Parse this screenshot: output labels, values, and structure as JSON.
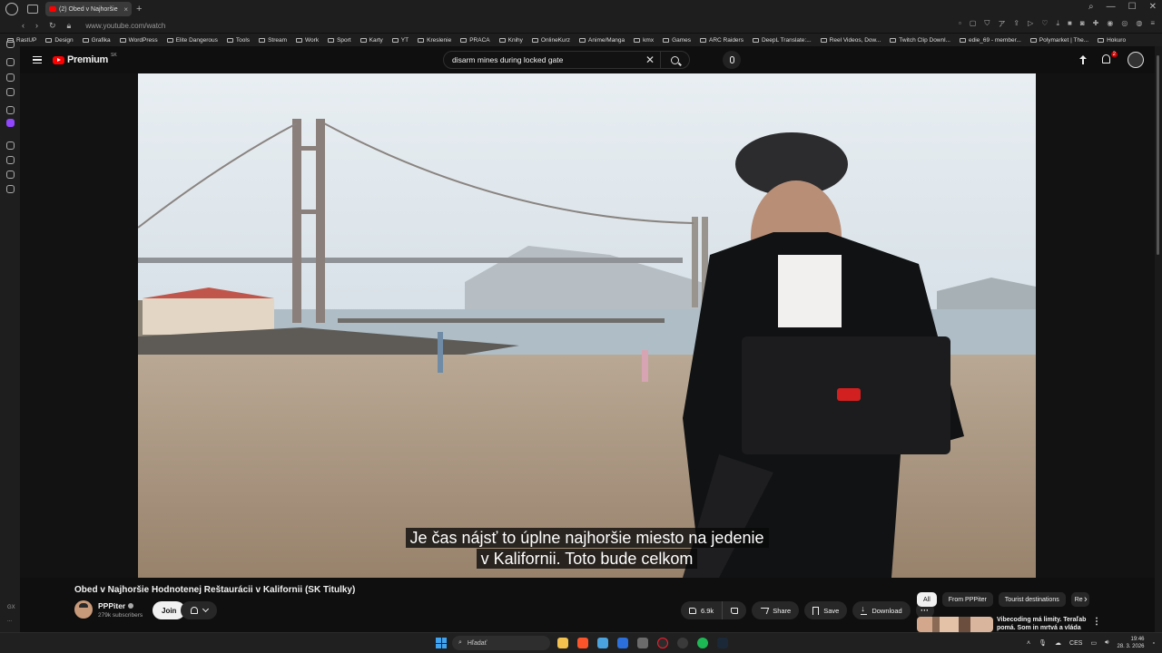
{
  "browser": {
    "tab_title": "(2) Obed v Najhoršie",
    "url": "www.youtube.com/watch",
    "bookmarks": [
      "RastUP",
      "Design",
      "Grafika",
      "WordPress",
      "Elite Dangerous",
      "Tools",
      "Stream",
      "Work",
      "Sport",
      "Karty",
      "YT",
      "Kreslenie",
      "PRACA",
      "Knihy",
      "OnlineKurz",
      "Anime/Manga",
      "kmx",
      "Games",
      "ARC Raiders",
      "DeepL Translate:...",
      "Reel Videos, Dow...",
      "Twitch Clip Downl...",
      "edie_69 - member...",
      "Polymarket | The...",
      "Hokuro"
    ]
  },
  "side_panel": {
    "bottom_labels": [
      "GX",
      "..."
    ]
  },
  "yt_header": {
    "logo_text": "Premium",
    "country_code": "SK",
    "search_value": "disarm mines during locked gate",
    "notifications_count": "2"
  },
  "video": {
    "captions": [
      "Je čas nájsť to úplne najhoršie miesto na jedenie",
      "v Kalifornii. Toto bude celkom"
    ]
  },
  "meta": {
    "title": "Obed v Najhoršie Hodnotenej Reštaurácii v Kalifornii (SK Titulky)",
    "channel": "PPPiter",
    "subscribers": "279k subscribers",
    "join_label": "Join",
    "like_count": "6.9k",
    "share_label": "Share",
    "save_label": "Save",
    "download_label": "Download",
    "more_label": "···"
  },
  "sidebar_recs": {
    "chips": [
      "All",
      "From PPPiter",
      "Tourist destinations",
      "Re"
    ],
    "rec_title": "Vibecoding má limity. Teraľab pomá. Som in mrtvá a vláda"
  },
  "taskbar": {
    "search_placeholder": "Hľadať",
    "lang": "CES",
    "time": "19:46",
    "date": "28. 3. 2026"
  }
}
